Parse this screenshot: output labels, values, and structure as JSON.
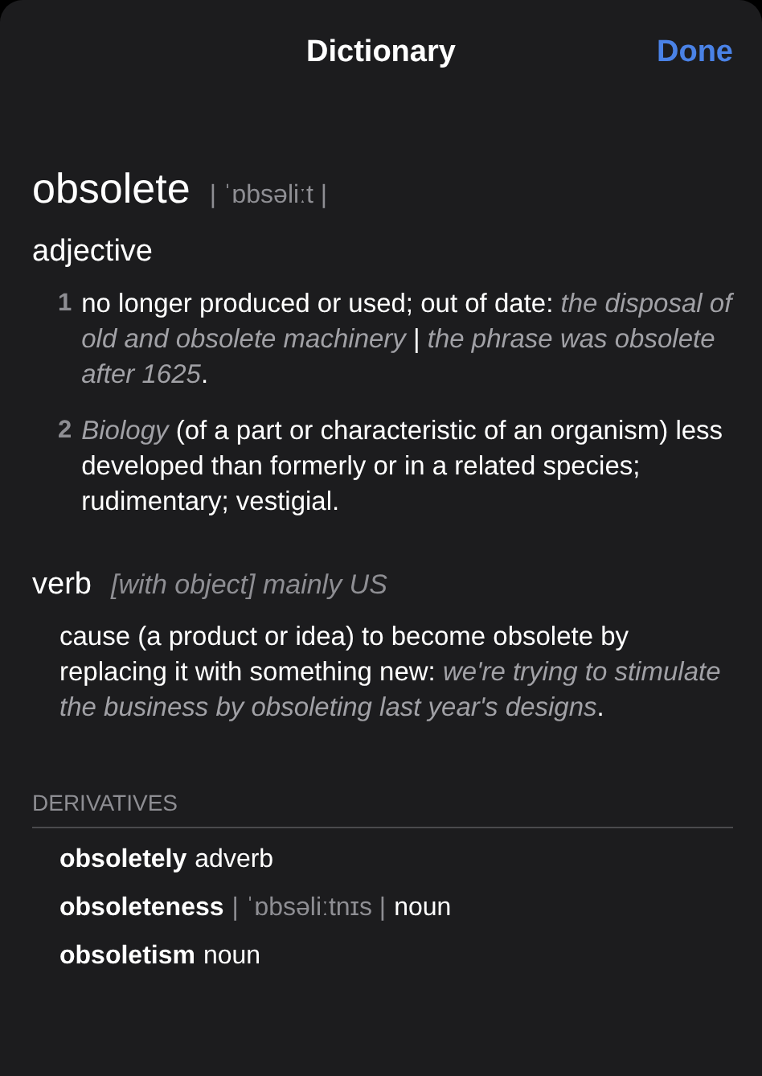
{
  "header": {
    "title": "Dictionary",
    "done_button": "Done"
  },
  "entry": {
    "headword": "obsolete",
    "pronunciation": "| ˈɒbsəliːt |"
  },
  "sections": [
    {
      "pos": "adjective",
      "senses": [
        {
          "number": "1",
          "text": "no longer produced or used; out of date: *the disposal of old and obsolete machinery* | *the phrase was obsolete after 1625*."
        },
        {
          "number": "2",
          "text": "*Biology* (of a part or characteristic of an organism) less developed than formerly or in a related species; rudimentary; vestigial."
        }
      ]
    },
    {
      "pos": "verb",
      "note": "[with object] mainly US",
      "senses": [
        {
          "text": "cause (a product or idea) to become obsolete by replacing it with something new: *we're trying to stimulate the business by obsoleting last year's designs*."
        }
      ]
    }
  ],
  "derivatives": {
    "heading": "DERIVATIVES",
    "items": [
      {
        "word": "obsoletely",
        "pos": "adverb"
      },
      {
        "word": "obsoleteness",
        "pronunciation": "| ˈɒbsəliːtnɪs |",
        "pos": "noun"
      },
      {
        "word": "obsoletism",
        "pos": "noun"
      }
    ]
  }
}
